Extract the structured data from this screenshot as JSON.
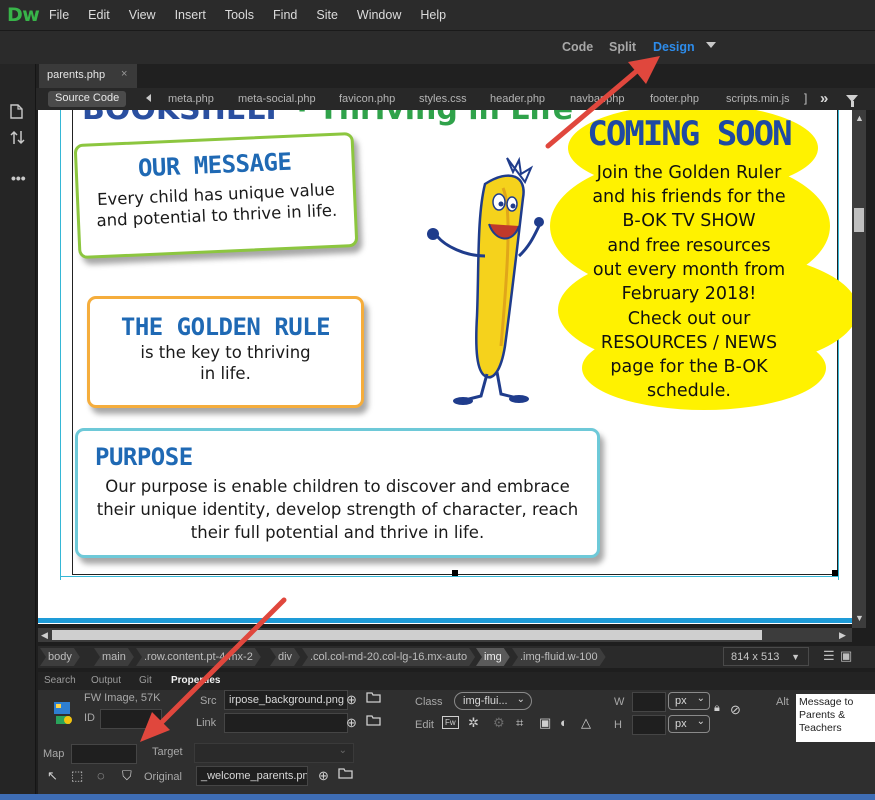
{
  "app": {
    "logo": "Dw"
  },
  "menu": [
    "File",
    "Edit",
    "View",
    "Insert",
    "Tools",
    "Find",
    "Site",
    "Window",
    "Help"
  ],
  "view_modes": {
    "code": "Code",
    "split": "Split",
    "design": "Design",
    "active": "Design"
  },
  "document": {
    "tab_name": "parents.php",
    "close_glyph": "×"
  },
  "related": {
    "source_code": "Source Code",
    "files": [
      "meta.php",
      "meta-social.php",
      "favicon.php",
      "styles.css",
      "header.php",
      "navbar.php",
      "footer.php",
      "scripts.min.js"
    ],
    "more_glyph": "»"
  },
  "page": {
    "headline_blue": "BOOKSHELF",
    "headline_sep": " · ",
    "headline_green": "Thriving in Life",
    "message": {
      "title": "OUR MESSAGE",
      "line1": "Every child has unique value",
      "line2": "and potential to thrive in life."
    },
    "golden_rule": {
      "title": "THE GOLDEN RULE",
      "line1": "is the key to thriving",
      "line2": "in life."
    },
    "purpose": {
      "title": "PURPOSE",
      "line1": "Our purpose is enable children to discover and embrace",
      "line2": "their unique identity, develop strength of character, reach",
      "line3": "their full potential and thrive in life."
    },
    "coming_soon": {
      "title": "COMING SOON",
      "lines": [
        "Join the Golden Ruler",
        "and his friends for the",
        "B-OK TV SHOW",
        "and free resources",
        "out every month from",
        "February 2018!",
        "Check out our",
        "RESOURCES / NEWS",
        "page for the B-OK",
        "schedule."
      ]
    },
    "colors": {
      "yellow": "#fff200",
      "title_blue": "#1f69b4",
      "green_border": "#8cc63f",
      "orange_border": "#f5ad3c",
      "teal_border": "#6ec9d8"
    }
  },
  "tag_selector": {
    "tags": [
      "body",
      "main",
      ".row.content.pt-4.mx-2",
      "div",
      ".col.col-md-20.col-lg-16.mx-auto",
      "img",
      ".img-fluid.w-100"
    ],
    "selected": "img",
    "size": "814 x 513"
  },
  "panel_tabs": [
    "Search",
    "Output",
    "Git",
    "Properties"
  ],
  "properties": {
    "type": "FW Image, 57K",
    "id_label": "ID",
    "id_value": "",
    "src_label": "Src",
    "src_value": "irpose_background.png",
    "link_label": "Link",
    "link_value": "",
    "class_label": "Class",
    "class_value": "img-flui...",
    "edit_label": "Edit",
    "w_label": "W",
    "h_label": "H",
    "w_unit": "px",
    "h_unit": "px",
    "w_value": "",
    "h_value": "",
    "alt_label": "Alt",
    "alt_value": "Message to Parents & Teachers",
    "map_label": "Map",
    "map_value": "",
    "target_label": "Target",
    "original_label": "Original",
    "original_value": "_welcome_parents.png"
  }
}
